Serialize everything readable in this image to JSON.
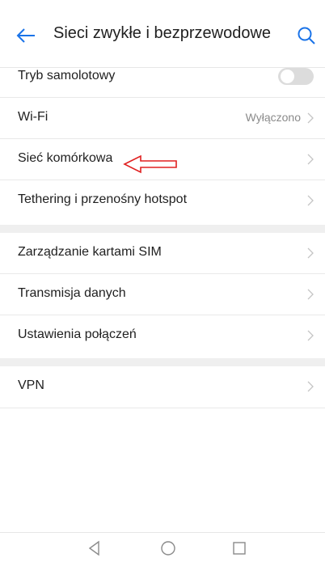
{
  "header": {
    "title": "Sieci zwykłe i bezprzewodowe",
    "back_icon": "arrow-left-icon",
    "search_icon": "search-icon"
  },
  "groups": [
    {
      "items": [
        {
          "label": "Tryb samolotowy",
          "control": "toggle",
          "state": "off"
        },
        {
          "label": "Wi-Fi",
          "value": "Wyłączono"
        },
        {
          "label": "Sieć komórkowa"
        },
        {
          "label": "Tethering i przenośny hotspot"
        }
      ]
    },
    {
      "items": [
        {
          "label": "Zarządzanie kartami SIM"
        },
        {
          "label": "Transmisja danych"
        },
        {
          "label": "Ustawienia połączeń"
        }
      ]
    },
    {
      "items": [
        {
          "label": "VPN"
        }
      ]
    }
  ],
  "annotation": {
    "type": "red-arrow",
    "points_to": "Sieć komórkowa",
    "color": "#e02020"
  },
  "navbar": {
    "icons": [
      "back-triangle-icon",
      "home-circle-icon",
      "recents-square-icon"
    ]
  },
  "colors": {
    "accent": "#1a73e8",
    "text": "#1f1f1f",
    "secondary": "#8a8a8a",
    "separator": "#efefef"
  }
}
